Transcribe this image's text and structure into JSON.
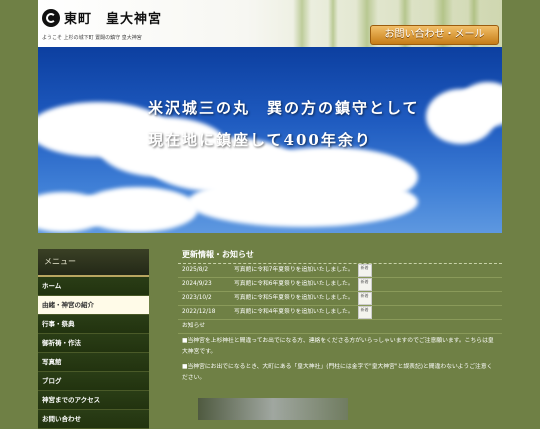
{
  "header": {
    "site_name": "東町　皇大神宮",
    "tagline": "ようこそ 上杉の城下町 置賜の鎮守 皇大神宮",
    "contact_label": "お問い合わせ・メール"
  },
  "hero": {
    "line1": "米沢城三の丸　巽の方の鎮守として",
    "line2": "現在地に鎮座して400年余り"
  },
  "menu": {
    "heading": "メニュー",
    "items": [
      {
        "label": "ホーム",
        "active": false
      },
      {
        "label": "由緒・神宮の紹介",
        "active": true
      },
      {
        "label": "行事・祭典",
        "active": false
      },
      {
        "label": "御祈祷・作法",
        "active": false
      },
      {
        "label": "写真館",
        "active": false
      },
      {
        "label": "ブログ",
        "active": false
      },
      {
        "label": "神宮までのアクセス",
        "active": false
      },
      {
        "label": "お問い合わせ",
        "active": false
      }
    ]
  },
  "news": {
    "heading": "更新情報・お知らせ",
    "badge": "新着",
    "rows": [
      {
        "date": "2025/8/2",
        "text": "写真館に令和7年夏祭りを追加いたしました。"
      },
      {
        "date": "2024/9/23",
        "text": "写真館に令和6年夏祭りを追加いたしました。"
      },
      {
        "date": "2023/10/2",
        "text": "写真館に令和5年夏祭りを追加いたしました。"
      },
      {
        "date": "2022/12/18",
        "text": "写真館に令和4年夏祭りを追加いたしました。"
      }
    ],
    "notice_heading": "お知らせ",
    "notices": [
      "■当神宮を上杉神社と間違ってお出でになる方、連絡をくださる方がいらっしゃいますのでご注意願います。こちらは皇大神宮です。",
      "■当神宮にお出でになるとき、大町にある「皇大神社」(門柱には金字で\"皇大神宮\"と誤表記)と間違わないようご注意ください。"
    ]
  }
}
